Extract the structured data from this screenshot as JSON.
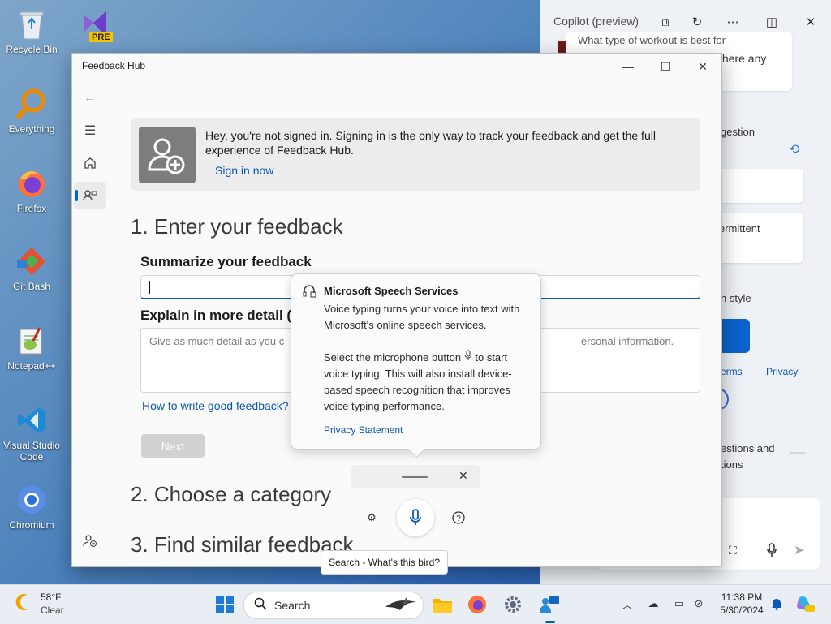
{
  "desktop": {
    "icons": [
      {
        "label": "Recycle Bin"
      },
      {
        "label": "Everything"
      },
      {
        "label": "Firefox"
      },
      {
        "label": "Git Bash"
      },
      {
        "label": "Notepad++"
      },
      {
        "label": "Visual Studio Code"
      },
      {
        "label": "Chromium"
      }
    ],
    "vs_badge": "PRE"
  },
  "copilot": {
    "title": "Copilot (preview)",
    "snippet_1": "What type of workout is best for",
    "snippet_2": "there any",
    "text_1": "gestion",
    "text_2": "ermittent",
    "text_3": "n style",
    "link_terms": "erms",
    "link_privacy": "Privacy",
    "text_4": "estions and",
    "text_5": "tions"
  },
  "feedback_hub": {
    "title": "Feedback Hub",
    "banner": {
      "text": "Hey, you're not signed in. Signing in is the only way to track your feedback and get the full experience of Feedback Hub.",
      "link": "Sign in now"
    },
    "section1": "1. Enter your feedback",
    "summarize_label": "Summarize your feedback",
    "explain_label": "Explain in more detail (",
    "explain_placeholder": "Give as much detail as you c",
    "explain_placeholder_2": "ersonal information.",
    "help_link": "How to write good feedback?",
    "next_button": "Next",
    "section2": "2. Choose a category",
    "section3": "3. Find similar feedback"
  },
  "speech_popup": {
    "title": "Microsoft Speech Services",
    "body_1": "Voice typing turns your voice into text with Microsoft's online speech services.",
    "body_2a": "Select the microphone button",
    "body_2b": "to start voice typing. This will also install device-based speech recognition that improves voice typing performance.",
    "link": "Privacy Statement"
  },
  "search_tooltip": "Search - What's this bird?",
  "taskbar": {
    "weather_temp": "58°F",
    "weather_cond": "Clear",
    "search_placeholder": "Search",
    "time": "11:38 PM",
    "date": "5/30/2024"
  },
  "colors": {
    "accent": "#0a58b5",
    "active_indicator": "#0067c0"
  }
}
